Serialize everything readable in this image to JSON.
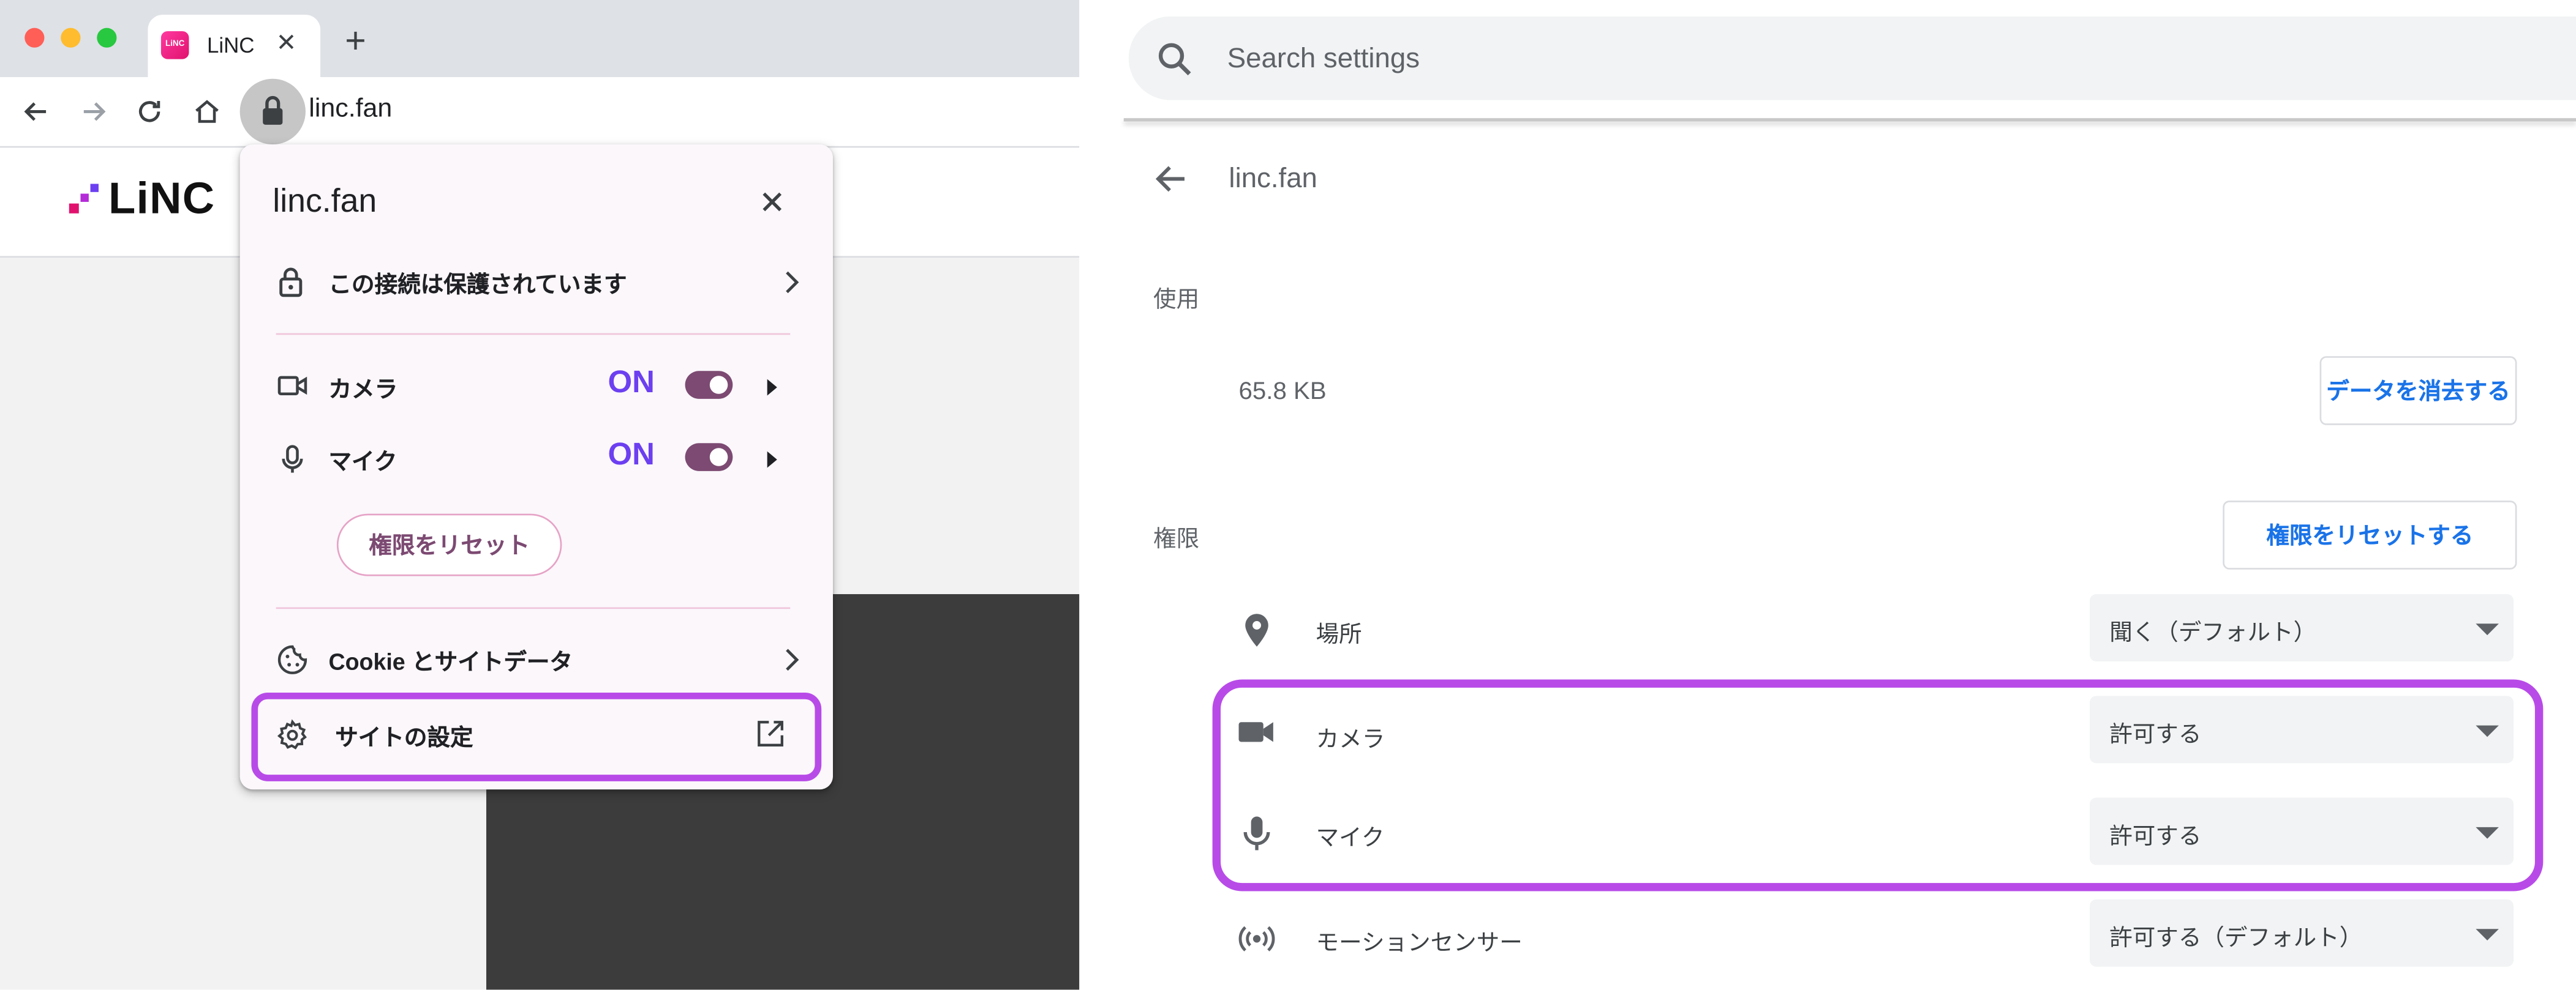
{
  "browser": {
    "tab": {
      "favicon_text": "LiNC",
      "title": "LiNC",
      "close_glyph": "✕"
    },
    "new_tab_glyph": "+",
    "url": "linc.fan",
    "logo_text": "LiNC"
  },
  "popup": {
    "title": "linc.fan",
    "connection": "この接続は保護されています",
    "permissions": [
      {
        "label": "カメラ",
        "state": "ON",
        "icon": "video-camera-icon"
      },
      {
        "label": "マイク",
        "state": "ON",
        "icon": "microphone-icon"
      }
    ],
    "reset_button": "権限をリセット",
    "cookies": "Cookie とサイトデータ",
    "site_settings": "サイトの設定"
  },
  "settings": {
    "search_placeholder": "Search settings",
    "site_title": "linc.fan",
    "usage_label": "使用",
    "usage_value": "65.8 KB",
    "clear_button": "データを消去する",
    "permissions_label": "権限",
    "reset_button": "権限をリセットする",
    "rows": [
      {
        "label": "場所",
        "value": "聞く（デフォルト）",
        "icon": "location-pin-icon"
      },
      {
        "label": "カメラ",
        "value": "許可する",
        "icon": "video-camera-icon"
      },
      {
        "label": "マイク",
        "value": "許可する",
        "icon": "microphone-icon"
      },
      {
        "label": "モーションセンサー",
        "value": "許可する（デフォルト）",
        "icon": "motion-sensor-icon"
      }
    ]
  },
  "colors": {
    "highlight": "#b84be8",
    "toggle_on": "#7c4a72",
    "on_text": "#6c3ff0",
    "link_blue": "#1a73e8",
    "logo_pink": "#e0126e"
  }
}
